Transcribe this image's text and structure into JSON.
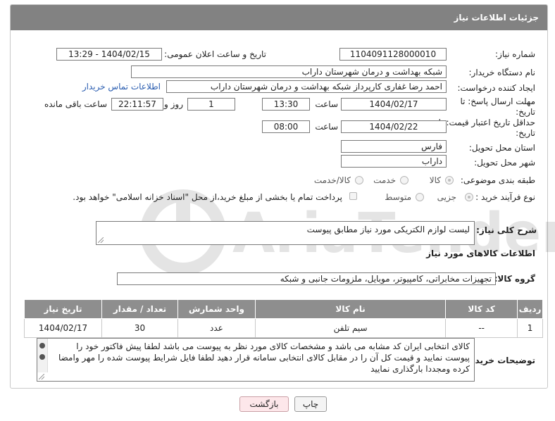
{
  "header": {
    "title": "جزئیات اطلاعات نیاز"
  },
  "form": {
    "need_number": {
      "label": "شماره نیاز:",
      "value": "1104091128000010"
    },
    "announce": {
      "label": "تاریخ و ساعت اعلان عمومی:",
      "value": "1404/02/15 - 13:29"
    },
    "buyer_org": {
      "label": "نام دستگاه خریدار:",
      "value": "شبکه بهداشت و درمان شهرستان داراب"
    },
    "creator": {
      "label": "ایجاد کننده درخواست:",
      "value": "احمد رضا غفاری کارپرداز شبکه بهداشت و درمان شهرستان داراب",
      "contact_link": "اطلاعات تماس خریدار"
    },
    "deadline": {
      "label": "مهلت ارسال پاسخ: تا تاریخ:",
      "date": "1404/02/17",
      "time_label": "ساعت",
      "time": "13:30",
      "days": "1",
      "days_label": "روز و",
      "remaining": "22:11:57",
      "remaining_label": "ساعت باقی مانده"
    },
    "validity": {
      "label": "حداقل تاریخ اعتبار قیمت: تا تاریخ:",
      "date": "1404/02/22",
      "time_label": "ساعت",
      "time": "08:00"
    },
    "province": {
      "label": "استان محل تحویل:",
      "value": "فارس"
    },
    "city": {
      "label": "شهر محل تحویل:",
      "value": "داراب"
    },
    "category": {
      "label": "طبقه بندی موضوعی:",
      "options": [
        "کالا",
        "خدمت",
        "کالا/خدمت"
      ]
    },
    "process": {
      "label": "نوع فرآیند خرید :",
      "options": [
        "جزیی",
        "متوسط"
      ],
      "payment_note": "پرداخت تمام یا بخشی از مبلغ خرید،از محل \"اسناد خزانه اسلامی\" خواهد بود."
    },
    "description": {
      "label": "شرح کلی نیاز:",
      "value": "لیست لوازم الکتریکی مورد نیاز مطابق پیوست"
    },
    "goods_section": {
      "title": "اطلاعات کالاهای مورد نیاز"
    },
    "goods_group": {
      "label": "گروه کالا:",
      "value": "تجهیزات مخابراتی، کامپیوتر، موبایل، ملزومات جانبی و شبکه"
    },
    "table": {
      "headers": [
        "ردیف",
        "کد کالا",
        "نام کالا",
        "واحد شمارش",
        "تعداد / مقدار",
        "تاریخ نیاز"
      ],
      "rows": [
        [
          "1",
          "--",
          "سیم تلفن",
          "عدد",
          "30",
          "1404/02/17"
        ]
      ]
    },
    "buyer_notes": {
      "label": "توضیحات خریدار:",
      "value": "کالای انتخابی ایران کد مشابه می باشد و مشخصات کالای مورد نظر به پیوست می باشد لطفا پیش فاکتور خود را پیوست نمایید و قیمت کل آن را در مقابل کالای انتخابی سامانه قرار دهید لطفا فایل شرایط پیوست شده را مهر وامضا کرده ومجددا بارگذاری نمایید"
    }
  },
  "buttons": {
    "print": "چاپ",
    "back": "بازگشت"
  },
  "watermark": {
    "text": "AriaTender.neT"
  }
}
